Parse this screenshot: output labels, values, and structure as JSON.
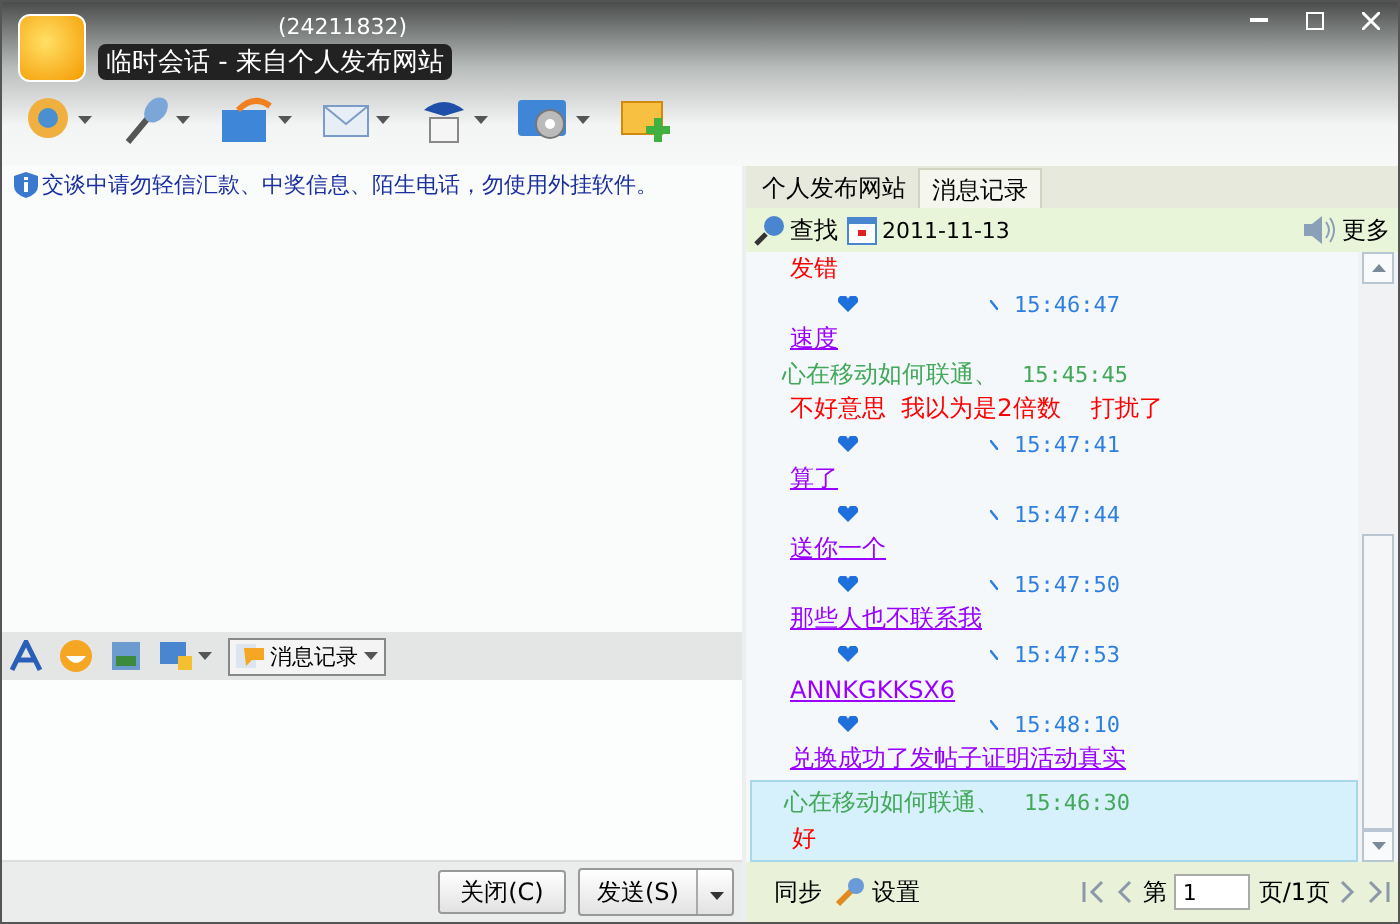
{
  "window": {
    "title": "临时会话 - 来自个人发布网站",
    "contact_id": "(24211832)"
  },
  "notice": "交谈中请勿轻信汇款、中奖信息、陌生电话，勿使用外挂软件。",
  "format_toolbar": {
    "history_button": "消息记录"
  },
  "buttons": [
    {
      "label": "关闭(C)",
      "kind": "plain"
    },
    {
      "label": "发送(S)",
      "kind": "split"
    }
  ],
  "tabs": [
    {
      "label": "个人发布网站",
      "selected": false
    },
    {
      "label": "消息记录",
      "selected": true
    }
  ],
  "history_toolbar": {
    "search": "查找",
    "date": "2011-11-13",
    "more": "更多"
  },
  "messages": [
    {
      "kind": "text",
      "text": "发错",
      "color": "#ff0000"
    },
    {
      "kind": "meta",
      "time": "15:46:47"
    },
    {
      "kind": "link",
      "text": "速度",
      "color": "#9900ff"
    },
    {
      "kind": "sender",
      "name": "心在移动如何联通、",
      "time": "15:45:45"
    },
    {
      "kind": "text",
      "text": "不好意思  我以为是2倍数    打扰了",
      "color": "#ff0000"
    },
    {
      "kind": "meta",
      "time": "15:47:41"
    },
    {
      "kind": "link",
      "text": "算了",
      "color": "#9900ff"
    },
    {
      "kind": "meta",
      "time": "15:47:44"
    },
    {
      "kind": "link",
      "text": "送你一个",
      "color": "#9900ff"
    },
    {
      "kind": "meta",
      "time": "15:47:50"
    },
    {
      "kind": "link",
      "text": "那些人也不联系我",
      "color": "#9900ff"
    },
    {
      "kind": "meta",
      "time": "15:47:53"
    },
    {
      "kind": "link",
      "text": "ANNKGKKSX6",
      "color": "#9900ff"
    },
    {
      "kind": "meta",
      "time": "15:48:10"
    },
    {
      "kind": "link",
      "text": "兑换成功了发帖子证明活动真实",
      "color": "#9900ff"
    }
  ],
  "highlighted": [
    {
      "kind": "sender",
      "name": "心在移动如何联通、",
      "time": "15:46:30"
    },
    {
      "kind": "text",
      "text": "好",
      "color": "#ff0000"
    }
  ],
  "footer": {
    "sync": "同步",
    "settings": "设置",
    "page_prefix": "第",
    "page": "1",
    "page_suffix": "页/1页"
  }
}
